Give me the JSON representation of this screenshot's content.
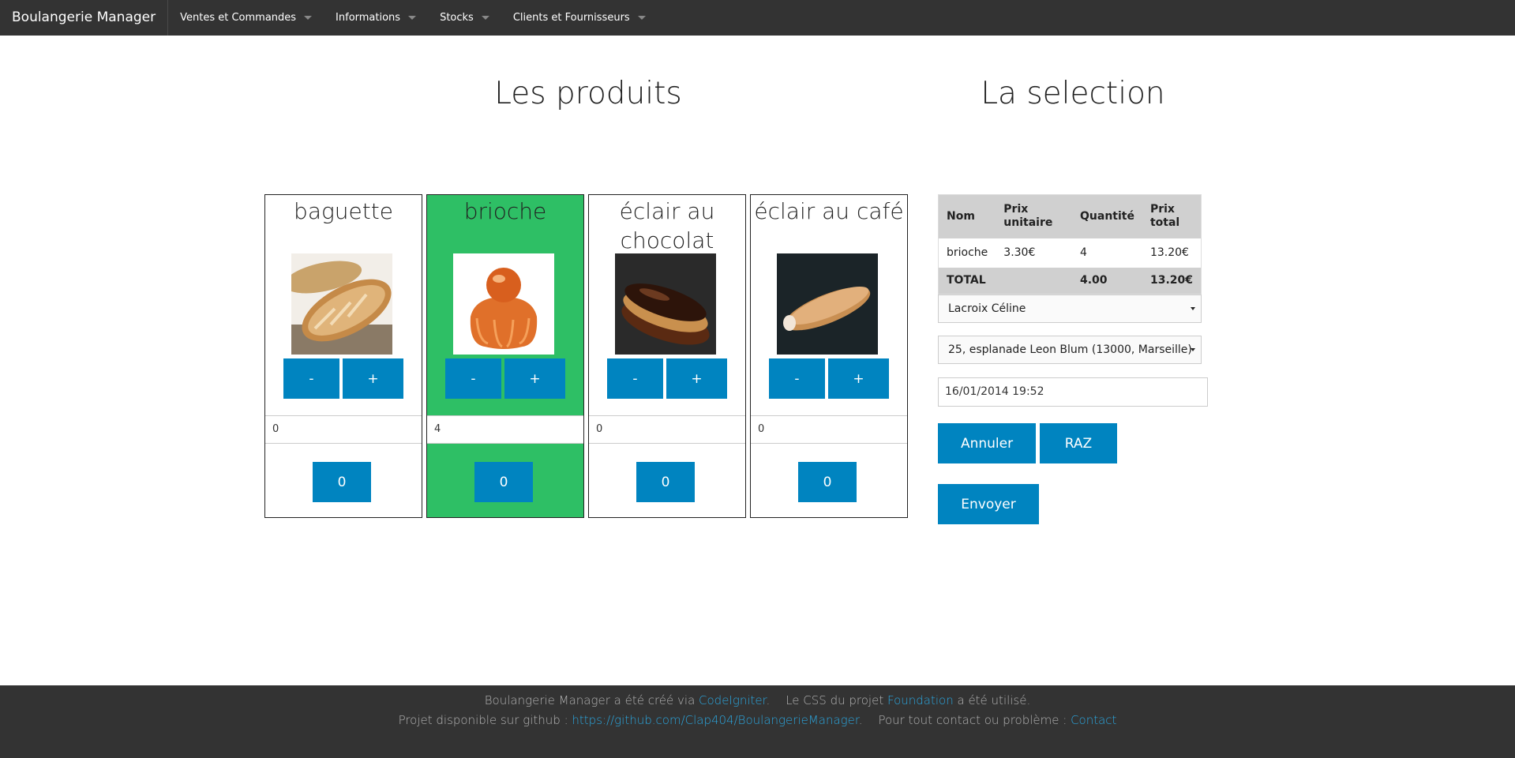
{
  "navbar": {
    "brand": "Boulangerie Manager",
    "menus": [
      "Ventes et Commandes",
      "Informations",
      "Stocks",
      "Clients et Fournisseurs"
    ]
  },
  "titles": {
    "products": "Les produits",
    "selection": "La selection"
  },
  "products": [
    {
      "name": "baguette",
      "minus": "-",
      "plus": "+",
      "quantity": "0",
      "counter": "0",
      "selected": false,
      "image": "baguette-image"
    },
    {
      "name": "brioche",
      "minus": "-",
      "plus": "+",
      "quantity": "4",
      "counter": "0",
      "selected": true,
      "image": "brioche-image"
    },
    {
      "name": "éclair au chocolat",
      "minus": "-",
      "plus": "+",
      "quantity": "0",
      "counter": "0",
      "selected": false,
      "image": "eclair-chocolat-image"
    },
    {
      "name": "éclair au café",
      "minus": "-",
      "plus": "+",
      "quantity": "0",
      "counter": "0",
      "selected": false,
      "image": "eclair-cafe-image"
    }
  ],
  "selection": {
    "headers": {
      "name": "Nom",
      "unit_price": "Prix unitaire",
      "quantity": "Quantité",
      "total_price": "Prix total"
    },
    "rows": [
      {
        "name": "brioche",
        "unit_price": "3.30€",
        "quantity": "4",
        "total_price": "13.20€"
      }
    ],
    "total": {
      "label": "TOTAL",
      "quantity": "4.00",
      "price": "13.20€"
    },
    "client": "Lacroix Céline",
    "address": "25, esplanade Leon Blum (13000, Marseille)",
    "datetime": "16/01/2014 19:52",
    "buttons": {
      "cancel": "Annuler",
      "reset": "RAZ",
      "send": "Envoyer"
    }
  },
  "footer": {
    "line1_a": "Boulangerie Manager a été créé via ",
    "line1_link1": "CodeIgniter",
    "line1_b": ".",
    "line1_c": "Le CSS du projet ",
    "line1_link2": "Foundation",
    "line1_d": " a été utilisé.",
    "line2_a": "Projet disponible sur github : ",
    "line2_link1": "https://github.com/Clap404/BoulangerieManager",
    "line2_b": ".",
    "line2_c": "Pour tout contact ou problème : ",
    "line2_link2": "Contact"
  },
  "colors": {
    "navbar": "#333333",
    "button": "#0084c0",
    "selected_card": "#2ebf65",
    "link": "#2ba6de"
  }
}
